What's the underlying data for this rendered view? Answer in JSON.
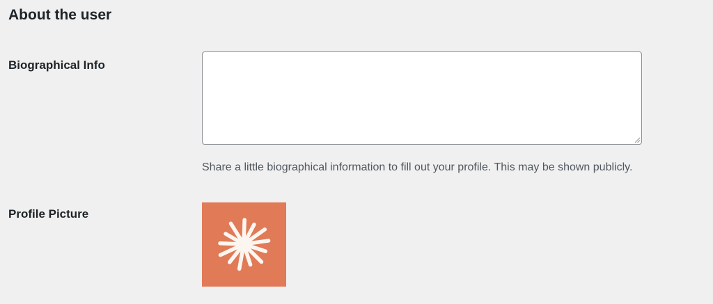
{
  "section": {
    "title": "About the user"
  },
  "bio": {
    "label": "Biographical Info",
    "value": "",
    "description": "Share a little biographical information to fill out your profile. This may be shown publicly."
  },
  "profile_picture": {
    "label": "Profile Picture",
    "avatar_icon": "asterisk-burst-icon",
    "background_color": "#e07a57",
    "icon_color": "#fdf6f0"
  },
  "colors": {
    "page_background": "#f0f0f1",
    "text": "#1d2327",
    "description_text": "#50575e",
    "input_border": "#8c8f94"
  }
}
